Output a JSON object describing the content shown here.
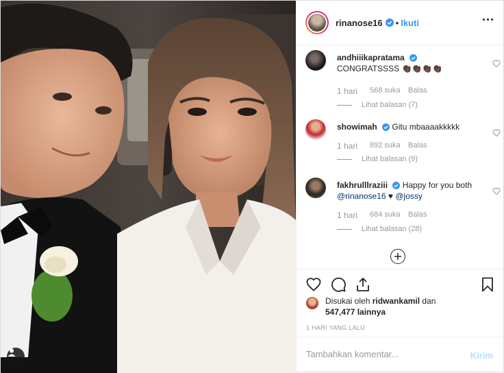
{
  "header": {
    "username": "rinanose16",
    "separator": "•",
    "follow_label": "Ikuti"
  },
  "comments": [
    {
      "username": "andhiiikapratama",
      "verified": true,
      "text": "CONGRATSSSS 👏🏿👏🏿👏🏿👏🏿",
      "time": "1 hari",
      "likes": "568 suka",
      "reply_label": "Balas",
      "view_replies": "Lihat balasan (7)"
    },
    {
      "username": "showimah",
      "verified": true,
      "text": "Gitu mbaaaakkkkk",
      "time": "1 hari",
      "likes": "892 suka",
      "reply_label": "Balas",
      "view_replies": "Lihat balasan (9)"
    },
    {
      "username": "fakhrulllraziii",
      "verified": true,
      "text": "Happy for you both",
      "mention1": "@rinanose16",
      "heart": "♥",
      "mention2": "@jossy",
      "time": "1 hari",
      "likes": "684 suka",
      "reply_label": "Balas",
      "view_replies": "Lihat balasan (28)"
    }
  ],
  "likes": {
    "prefix": "Disukai oleh",
    "user": "ridwankamil",
    "and": "dan",
    "count": "547,477 lainnya"
  },
  "posted_time": "1 HARI YANG LALU",
  "comment_box": {
    "placeholder": "Tambahkan komentar...",
    "send_label": "Kirim"
  },
  "icons": {
    "verified": "verified-badge-icon",
    "like": "heart-icon",
    "comment": "comment-bubble-icon",
    "share": "share-icon",
    "save": "bookmark-icon",
    "more": "more-options-icon",
    "load_more": "plus-circle-icon",
    "user_tag": "user-tag-icon"
  },
  "colors": {
    "link": "#3897f0",
    "verified": "#3897f0",
    "muted": "#999999",
    "text": "#262626",
    "send_disabled": "#b2dffc"
  }
}
